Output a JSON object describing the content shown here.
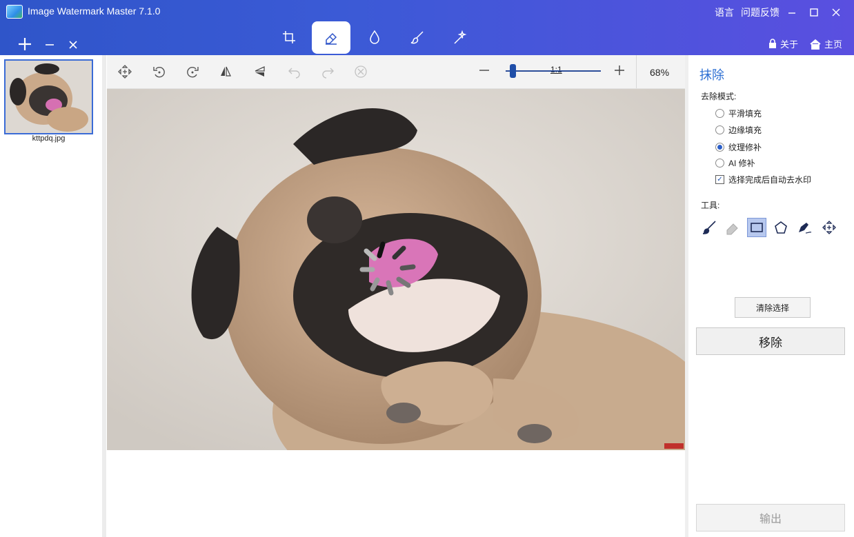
{
  "window": {
    "title": "Image Watermark Master 7.1.0",
    "lang": "语言",
    "feedback": "问题反馈",
    "about": "关于",
    "home": "主页"
  },
  "main_tabs": [
    {
      "name": "crop-icon",
      "active": false
    },
    {
      "name": "eraser-icon",
      "active": true
    },
    {
      "name": "drop-icon",
      "active": false
    },
    {
      "name": "brush-icon",
      "active": false
    },
    {
      "name": "magic-wand-icon",
      "active": false
    }
  ],
  "files": {
    "items": [
      {
        "filename": "kttpdq.jpg",
        "selected": true
      }
    ]
  },
  "toolbar": {
    "ratio_label": "1:1",
    "zoom_level": "68%",
    "zoom_fraction": 0.07
  },
  "panel": {
    "title": "抹除",
    "mode_label": "去除模式:",
    "modes": [
      {
        "label": "平滑填充",
        "selected": false
      },
      {
        "label": "边缘填充",
        "selected": false
      },
      {
        "label": "纹理修补",
        "selected": true
      },
      {
        "label": "AI 修补",
        "selected": false
      }
    ],
    "auto_remove_label": "选择完成后自动去水印",
    "auto_remove_checked": true,
    "tools_label": "工具:",
    "clear_label": "清除选择",
    "remove_label": "移除",
    "export_label": "输出"
  },
  "colors": {
    "titlebar_start": "#2f55c9",
    "titlebar_end": "#5a4fe0",
    "accent": "#2d6fd3"
  }
}
